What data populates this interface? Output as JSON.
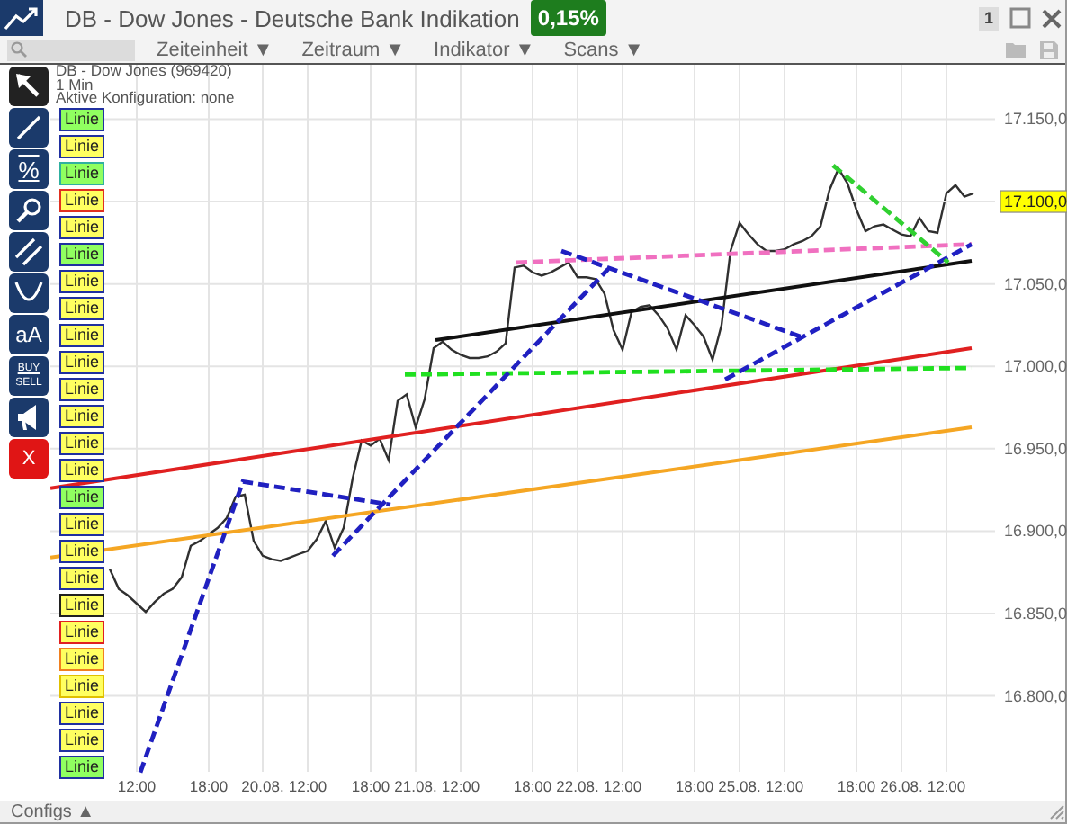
{
  "window": {
    "title": "DB - Dow Jones - Deutsche Bank Indikation",
    "change": "0,15%",
    "counter": "1"
  },
  "menus": [
    {
      "label": "Zeiteinheit",
      "caret": "▼"
    },
    {
      "label": "Zeitraum",
      "caret": "▼"
    },
    {
      "label": "Indikator",
      "caret": "▼"
    },
    {
      "label": "Scans",
      "caret": "▼"
    }
  ],
  "info": [
    "DB - Dow Jones (969420)",
    "1 Min",
    "Aktive Konfiguration: none"
  ],
  "tools": [
    {
      "kind": "pointer",
      "selected": true
    },
    {
      "kind": "line",
      "selected": false
    },
    {
      "kind": "percent",
      "text": "%",
      "selected": false
    },
    {
      "kind": "zoom",
      "selected": false
    },
    {
      "kind": "parallel",
      "selected": false
    },
    {
      "kind": "curve",
      "selected": false
    },
    {
      "kind": "text",
      "text": "aA",
      "selected": false
    },
    {
      "kind": "buysell",
      "text": "BUY",
      "text2": "SELL",
      "selected": false
    },
    {
      "kind": "alert",
      "selected": false
    },
    {
      "kind": "delete",
      "text": "X",
      "selected": false
    }
  ],
  "line_labels": [
    {
      "label": "Linie",
      "active": true,
      "color": "#2030a0"
    },
    {
      "label": "Linie",
      "active": false,
      "color": "#2030a0"
    },
    {
      "label": "Linie",
      "active": true,
      "color": "#30b0a0"
    },
    {
      "label": "Linie",
      "active": false,
      "color": "#e03020"
    },
    {
      "label": "Linie",
      "active": false,
      "color": "#2030a0"
    },
    {
      "label": "Linie",
      "active": true,
      "color": "#2030a0"
    },
    {
      "label": "Linie",
      "active": false,
      "color": "#2030a0"
    },
    {
      "label": "Linie",
      "active": false,
      "color": "#2030a0"
    },
    {
      "label": "Linie",
      "active": false,
      "color": "#2030a0"
    },
    {
      "label": "Linie",
      "active": false,
      "color": "#2030a0"
    },
    {
      "label": "Linie",
      "active": false,
      "color": "#2030a0"
    },
    {
      "label": "Linie",
      "active": false,
      "color": "#2030a0"
    },
    {
      "label": "Linie",
      "active": false,
      "color": "#2030a0"
    },
    {
      "label": "Linie",
      "active": false,
      "color": "#2030a0"
    },
    {
      "label": "Linie",
      "active": true,
      "color": "#2030a0"
    },
    {
      "label": "Linie",
      "active": false,
      "color": "#2030a0"
    },
    {
      "label": "Linie",
      "active": false,
      "color": "#2030a0"
    },
    {
      "label": "Linie",
      "active": false,
      "color": "#2030a0"
    },
    {
      "label": "Linie",
      "active": false,
      "color": "#202020"
    },
    {
      "label": "Linie",
      "active": false,
      "color": "#e02020"
    },
    {
      "label": "Linie",
      "active": false,
      "color": "#f08020"
    },
    {
      "label": "Linie",
      "active": false,
      "color": "#e0c000"
    },
    {
      "label": "Linie",
      "active": false,
      "color": "#2030a0"
    },
    {
      "label": "Linie",
      "active": false,
      "color": "#2030a0"
    },
    {
      "label": "Linie",
      "active": true,
      "color": "#2030a0"
    }
  ],
  "chart": {
    "price_label": "17.100,0",
    "drawings": [
      {
        "kind": "solid",
        "color": "#e02020"
      },
      {
        "kind": "solid",
        "color": "#f5a623"
      },
      {
        "kind": "solid",
        "color": "#101010"
      },
      {
        "kind": "dashed",
        "color": "#20e020"
      },
      {
        "kind": "dashed",
        "color": "#f070c0"
      },
      {
        "kind": "dashed",
        "color": "#2020c0"
      },
      {
        "kind": "dashed",
        "color": "#2020c1"
      },
      {
        "kind": "dashed",
        "color": "#2020c2"
      },
      {
        "kind": "dashed",
        "color": "#2020c3"
      },
      {
        "kind": "dashed",
        "color": "#30d030"
      }
    ],
    "chart_data": {
      "type": "line",
      "grid": true,
      "ylim": [
        16755,
        17183
      ],
      "categories": [
        null,
        null,
        null,
        null,
        null,
        null,
        null,
        null,
        null,
        "12:00",
        null,
        null,
        null,
        null,
        null,
        null,
        null,
        "18:00",
        null,
        null,
        null,
        null,
        null,
        "20.08.",
        null,
        null,
        null,
        null,
        "12:00",
        null,
        null,
        null,
        null,
        null,
        null,
        "18:00",
        null,
        null,
        null,
        null,
        "21.08.",
        null,
        null,
        null,
        null,
        "12:00",
        null,
        null,
        null,
        null,
        null,
        null,
        null,
        "18:00",
        null,
        null,
        null,
        null,
        "22.08.",
        null,
        null,
        null,
        null,
        "12:00",
        null,
        null,
        null,
        null,
        null,
        null,
        null,
        "18:00",
        null,
        null,
        null,
        null,
        "25.08.",
        null,
        null,
        null,
        null,
        "12:00",
        null,
        null,
        null,
        null,
        null,
        null,
        null,
        "18:00",
        null,
        null,
        null,
        null,
        "26.08.",
        null,
        null,
        null,
        null,
        "12:00",
        null,
        null,
        null
      ],
      "yticks": [
        {
          "value": 16800,
          "label": "16.800,0"
        },
        {
          "value": 16850,
          "label": "16.850,0"
        },
        {
          "value": 16900,
          "label": "16.900,0"
        },
        {
          "value": 16950,
          "label": "16.950,0"
        },
        {
          "value": 17000,
          "label": "17.000,0"
        },
        {
          "value": 17050,
          "label": "17.050,0"
        },
        {
          "value": 17150,
          "label": "17.150,0"
        }
      ],
      "series": [
        {
          "color": "#303030",
          "values": [
            null,
            null,
            null,
            null,
            null,
            null,
            16877,
            16865,
            16861,
            16856,
            16851,
            16857,
            16862,
            16865,
            16872,
            16891,
            16894,
            16898,
            16902,
            16908,
            16921,
            16922,
            16894,
            16885,
            16883,
            16882,
            16884,
            16886,
            16888,
            16895,
            16906,
            16890,
            16902,
            16932,
            16955,
            16952,
            16956,
            16943,
            16979,
            16983,
            16963,
            16980,
            17011,
            17015,
            17010,
            17007,
            17005,
            17005,
            17006,
            17009,
            17014,
            17060,
            17061,
            17057,
            17055,
            17057,
            17060,
            17063,
            17054,
            17054,
            17053,
            17044,
            17022,
            17010,
            17033,
            17036,
            17037,
            17031,
            17023,
            17010,
            17031,
            17025,
            17018,
            17004,
            17025,
            17070,
            17087,
            17080,
            17074,
            17070,
            17070,
            17071,
            17074,
            17076,
            17079,
            17085,
            17107,
            17120,
            17111,
            17095,
            17082,
            17085,
            17086,
            17083,
            17080,
            17079,
            17090,
            17082,
            17081,
            17105,
            17110,
            17103,
            17105
          ]
        }
      ]
    }
  },
  "footer": {
    "label": "Configs",
    "caret": "▲"
  }
}
